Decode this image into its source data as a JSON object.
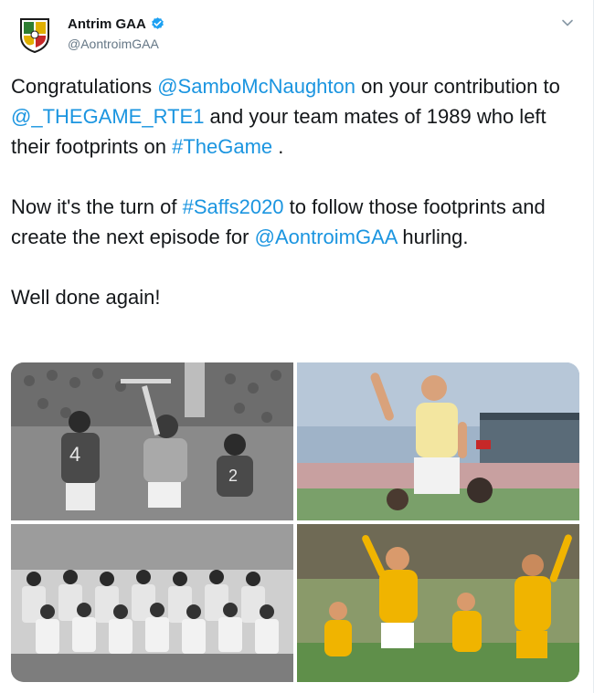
{
  "tweet": {
    "display_name": "Antrim GAA",
    "handle": "@AontroimGAA",
    "paragraphs": [
      [
        {
          "text": "Congratulations ",
          "link": false
        },
        {
          "text": "@SamboMcNaughton",
          "link": true
        },
        {
          "text": " on your contribution to ",
          "link": false
        },
        {
          "text": "@_THEGAME_RTE1",
          "link": true
        },
        {
          "text": " and your team mates of 1989 who left their footprints on ",
          "link": false
        },
        {
          "text": "#TheGame",
          "link": true
        },
        {
          "text": " .",
          "link": false
        }
      ],
      [
        {
          "text": "Now it's the turn of ",
          "link": false
        },
        {
          "text": "#Saffs2020",
          "link": true
        },
        {
          "text": " to follow those footprints and create the next episode for ",
          "link": false
        },
        {
          "text": "@AontroimGAA",
          "link": true
        },
        {
          "text": " hurling.",
          "link": false
        }
      ],
      [
        {
          "text": "Well done again!",
          "link": false
        }
      ]
    ]
  },
  "colors": {
    "link": "#1b95e0",
    "verified": "#1da1f2",
    "saffron": "#f4c430"
  },
  "icons": {
    "verified": "verified-badge-icon",
    "menu": "chevron-down-icon"
  }
}
